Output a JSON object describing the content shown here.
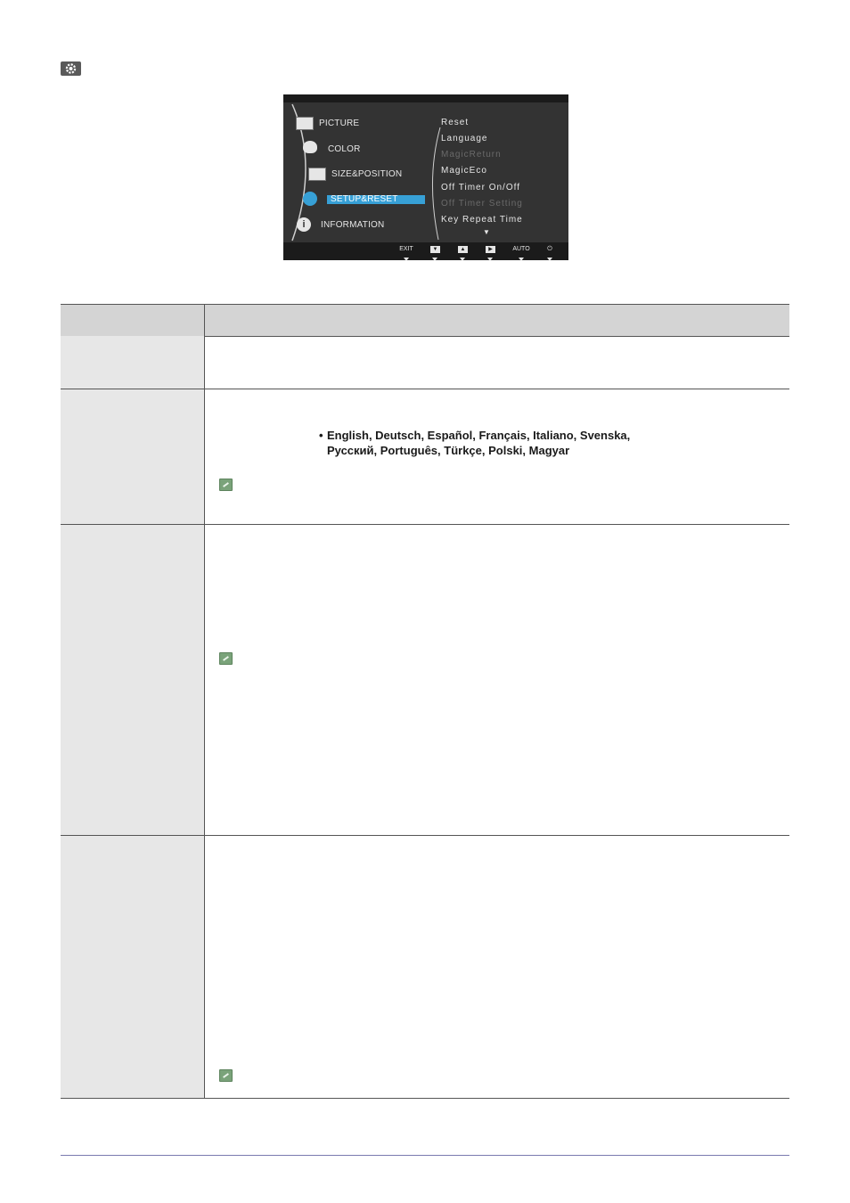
{
  "osd": {
    "left_menu": [
      "PICTURE",
      "COLOR",
      "SIZE&POSITION",
      "SETUP&RESET",
      "INFORMATION"
    ],
    "active_item": "SETUP&RESET",
    "right_menu": [
      {
        "label": "Reset",
        "enabled": true
      },
      {
        "label": "Language",
        "enabled": true
      },
      {
        "label": "MagicReturn",
        "enabled": false
      },
      {
        "label": "MagicEco",
        "enabled": true
      },
      {
        "label": "Off Timer On/Off",
        "enabled": true
      },
      {
        "label": "Off Timer Setting",
        "enabled": false
      },
      {
        "label": "Key Repeat Time",
        "enabled": true
      }
    ],
    "more_arrow": "▼",
    "buttons": [
      "EXIT",
      "▼",
      "▲",
      "▶",
      "AUTO",
      "⏻"
    ],
    "highlight_color": "#37a0d6"
  },
  "table": {
    "languages_line1": "English, Deutsch, Español, Français, Italiano, Svenska,",
    "languages_line2": "Русский, Português, Türkçe, Polski, Magyar",
    "bullet": "•"
  },
  "icons": [
    "gear-icon",
    "note-icon"
  ]
}
